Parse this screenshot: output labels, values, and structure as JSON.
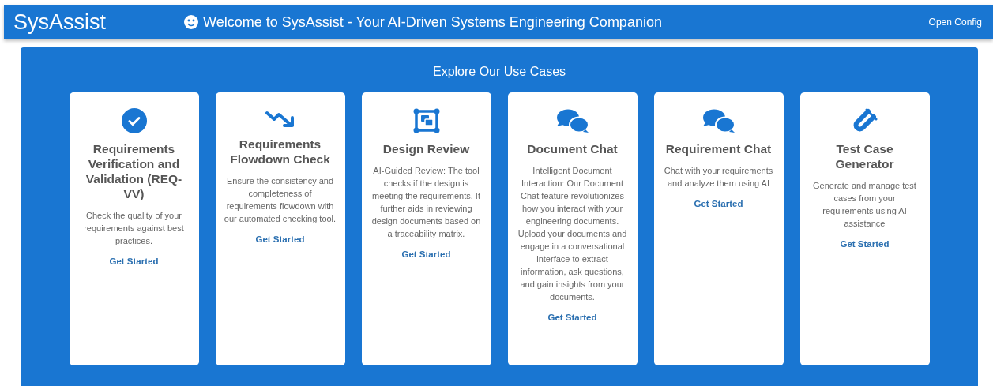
{
  "header": {
    "brand": "SysAssist",
    "welcome": "Welcome to SysAssist - Your AI-Driven Systems Engineering Companion",
    "config_link": "Open Config"
  },
  "section": {
    "title": "Explore Our Use Cases"
  },
  "cards": [
    {
      "kind": "check",
      "title": "Requirements Verification and Validation (REQ-VV)",
      "description": "Check the quality of your requirements against best practices.",
      "action": "Get Started"
    },
    {
      "kind": "trend",
      "title": "Requirements Flowdown Check",
      "description": "Ensure the consistency and completeness of requirements flowdown with our automated checking tool.",
      "action": "Get Started"
    },
    {
      "kind": "frame",
      "title": "Design Review",
      "description": "AI-Guided Review: The tool checks if the design is meeting the requirements. It further aids in reviewing design documents based on a traceability matrix.",
      "action": "Get Started"
    },
    {
      "kind": "chat",
      "title": "Document Chat",
      "description": "Intelligent Document Interaction: Our Document Chat feature revolutionizes how you interact with your engineering documents. Upload your documents and engage in a conversational interface to extract information, ask questions, and gain insights from your documents.",
      "action": "Get Started"
    },
    {
      "kind": "chat",
      "title": "Requirement Chat",
      "description": "Chat with your requirements and analyze them using AI",
      "action": "Get Started"
    },
    {
      "kind": "flask",
      "title": "Test Case Generator",
      "description": "Generate and manage test cases from your requirements using AI assistance",
      "action": "Get Started"
    }
  ]
}
